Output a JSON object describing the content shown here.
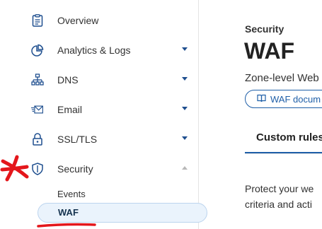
{
  "sidebar": {
    "items": [
      {
        "label": "Overview",
        "icon": "clipboard-icon"
      },
      {
        "label": "Analytics & Logs",
        "icon": "pie-chart-icon"
      },
      {
        "label": "DNS",
        "icon": "network-icon"
      },
      {
        "label": "Email",
        "icon": "email-icon"
      },
      {
        "label": "SSL/TLS",
        "icon": "lock-icon"
      },
      {
        "label": "Security",
        "icon": "shield-icon"
      }
    ],
    "security_subitems": {
      "events": "Events",
      "waf": "WAF"
    }
  },
  "main": {
    "breadcrumb": "Security",
    "title": "WAF",
    "subtitle": "Zone-level Web",
    "doc_button": "WAF docum",
    "tabs": {
      "custom_rules": "Custom rules"
    },
    "body_line1": "Protect your we",
    "body_line2": "criteria and acti"
  },
  "colors": {
    "accent": "#1f5fa8",
    "active_bg": "#eaf3fc",
    "annotation": "#e4161b"
  }
}
